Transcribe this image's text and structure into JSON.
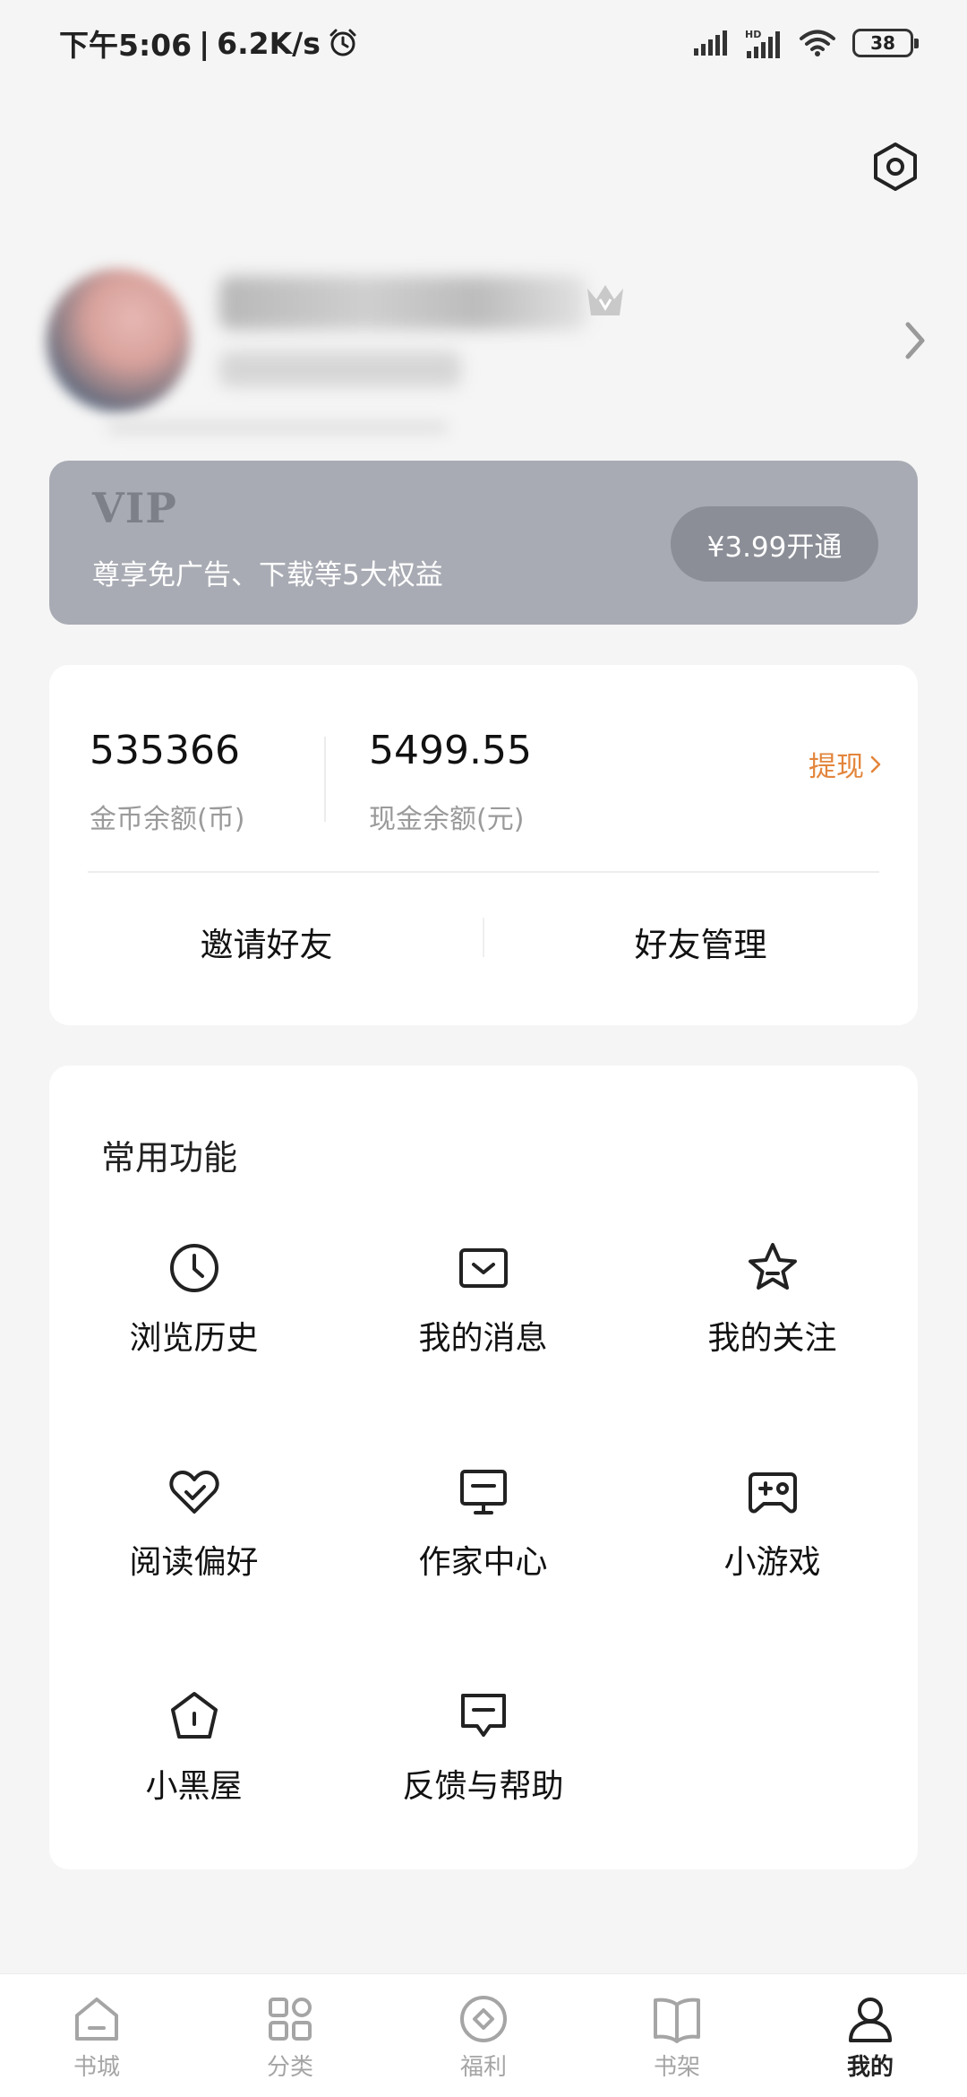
{
  "status_bar": {
    "time": "下午5:06",
    "speed": "6.2K/s",
    "battery": "38",
    "icons": [
      "alarm-icon",
      "signal-icon",
      "hd-signal-icon",
      "wifi-icon",
      "battery-icon"
    ]
  },
  "header": {
    "settings_icon": "settings-hex-icon"
  },
  "profile": {
    "arrow_icon": "chevron-right-icon",
    "crown_icon": "crown-icon"
  },
  "vip": {
    "logo": "VIP",
    "description": "尊享免广告、下载等5大权益",
    "button": "¥3.99开通"
  },
  "wallet": {
    "coin_value": "535366",
    "coin_label": "金币余额(币)",
    "cash_value": "5499.55",
    "cash_label": "现金余额(元)",
    "withdraw": "提现",
    "invite": "邀请好友",
    "manage": "好友管理",
    "accent_color": "#e3853c"
  },
  "functions": {
    "title": "常用功能",
    "items": [
      {
        "label": "浏览历史",
        "icon": "clock-icon"
      },
      {
        "label": "我的消息",
        "icon": "message-icon"
      },
      {
        "label": "我的关注",
        "icon": "star-icon"
      },
      {
        "label": "阅读偏好",
        "icon": "heart-check-icon"
      },
      {
        "label": "作家中心",
        "icon": "monitor-icon"
      },
      {
        "label": "小游戏",
        "icon": "gamepad-icon"
      },
      {
        "label": "小黑屋",
        "icon": "house-icon"
      },
      {
        "label": "反馈与帮助",
        "icon": "feedback-icon"
      }
    ]
  },
  "tabbar": {
    "tabs": [
      {
        "label": "书城",
        "icon": "home-icon",
        "active": false
      },
      {
        "label": "分类",
        "icon": "grid-icon",
        "active": false
      },
      {
        "label": "福利",
        "icon": "coin-icon",
        "active": false
      },
      {
        "label": "书架",
        "icon": "book-icon",
        "active": false
      },
      {
        "label": "我的",
        "icon": "user-icon",
        "active": true
      }
    ]
  }
}
